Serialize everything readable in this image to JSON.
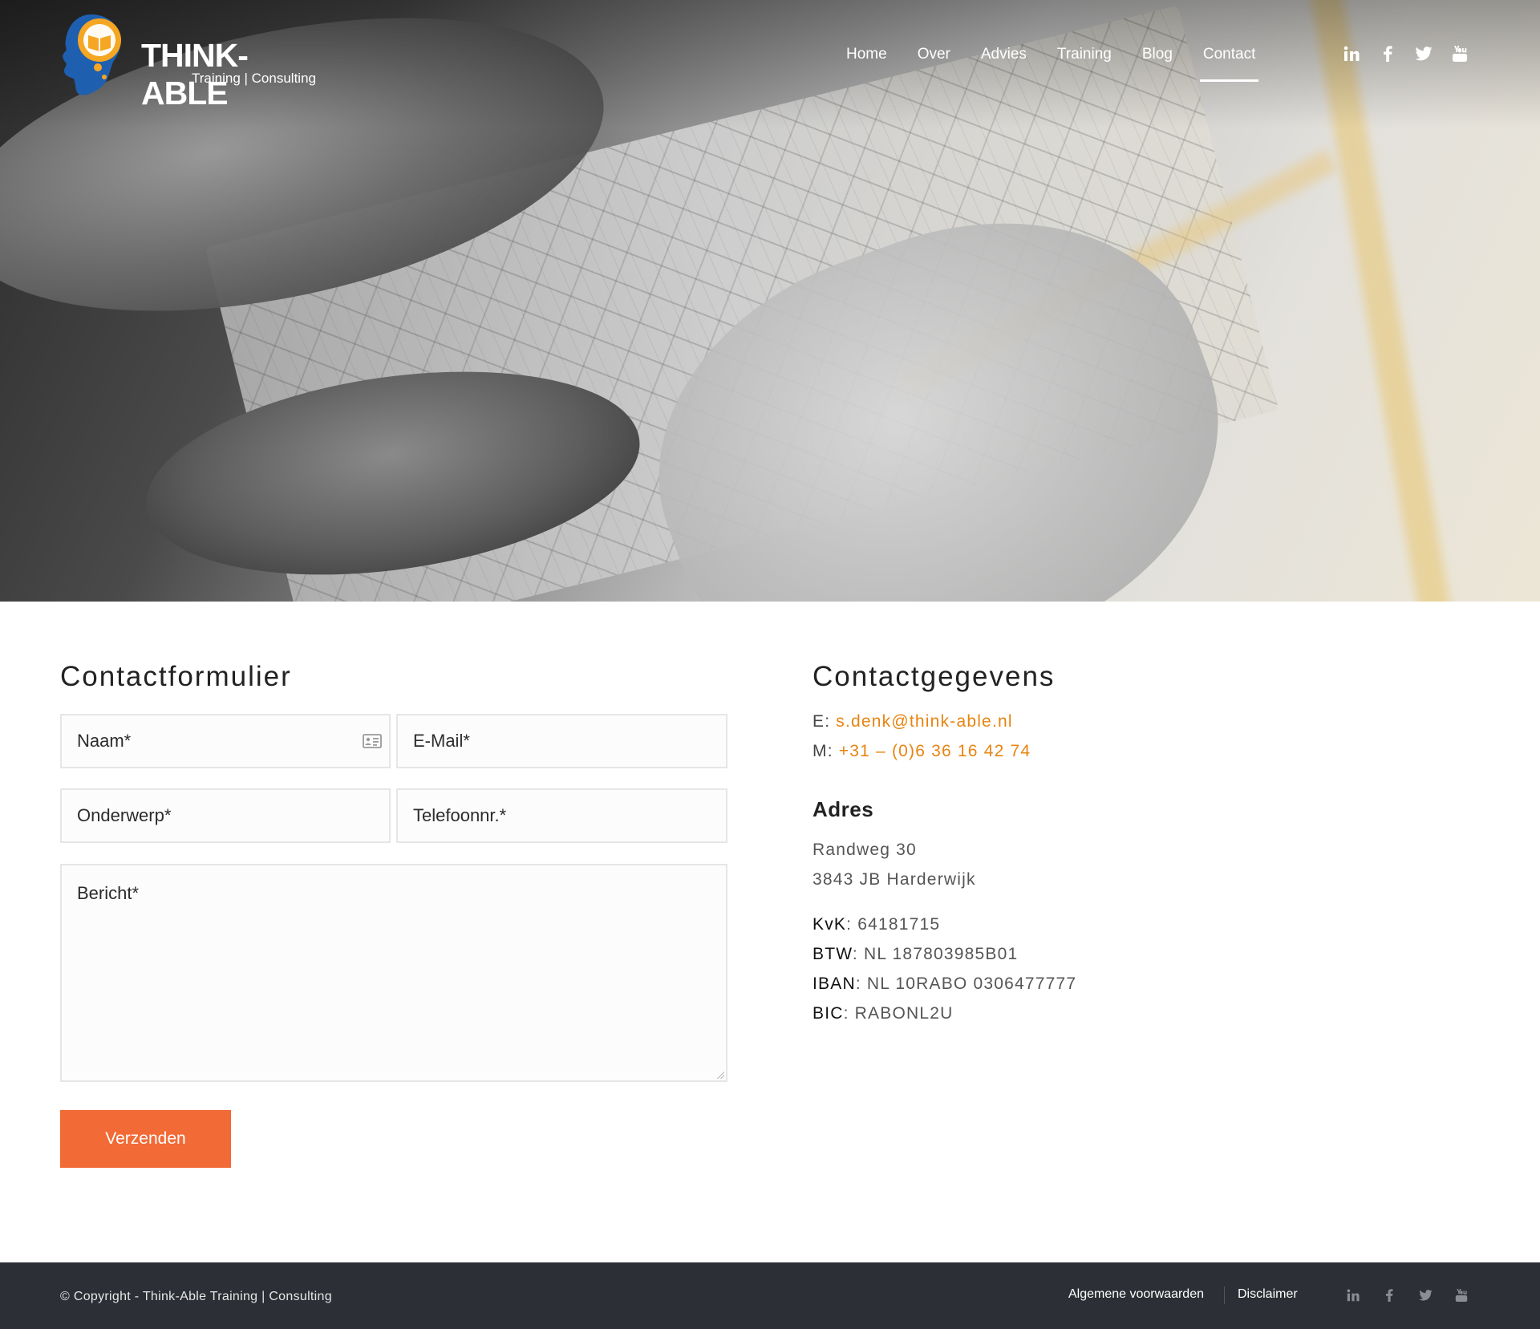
{
  "brand": {
    "name": "THINK-ABLE",
    "tagline": "Training | Consulting"
  },
  "nav": {
    "items": [
      {
        "label": "Home"
      },
      {
        "label": "Over"
      },
      {
        "label": "Advies"
      },
      {
        "label": "Training"
      },
      {
        "label": "Blog"
      },
      {
        "label": "Contact",
        "active": true
      }
    ]
  },
  "social": {
    "icons": [
      "linkedin-icon",
      "facebook-icon",
      "twitter-icon",
      "youtube-icon"
    ]
  },
  "form": {
    "title": "Contactformulier",
    "name_placeholder": "Naam*",
    "email_placeholder": "E-Mail*",
    "subject_placeholder": "Onderwerp*",
    "phone_placeholder": "Telefoonnr.*",
    "message_placeholder": "Bericht*",
    "submit_label": "Verzenden"
  },
  "contact": {
    "title": "Contactgegevens",
    "email_label": "E:",
    "email_value": "s.denk@think-able.nl",
    "phone_label": "M:",
    "phone_value": "+31 – (0)6 36 16 42 74",
    "address_title": "Adres",
    "street": "Randweg 30",
    "city": "3843 JB Harderwijk",
    "kvk_label": "KvK",
    "kvk_value": ": 64181715",
    "btw_label": "BTW",
    "btw_value": ": NL 187803985B01",
    "iban_label": "IBAN",
    "iban_value": ": NL 10RABO 0306477777",
    "bic_label": "BIC",
    "bic_value": ": RABONL2U"
  },
  "footer": {
    "copyright": "© Copyright - Think-Able Training | Consulting",
    "link_terms": "Algemene voorwaarden",
    "link_disclaimer": "Disclaimer"
  },
  "colors": {
    "accent": "#f26a35",
    "link": "#e88410",
    "footer_bg": "#2c2f35",
    "logo_blue": "#1f5fb0",
    "logo_orange": "#f5a623"
  }
}
